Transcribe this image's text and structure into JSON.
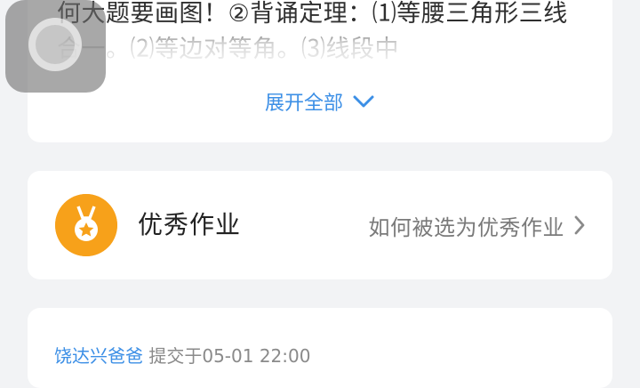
{
  "description": {
    "text": "何大题要画图！②背诵定理：⑴等腰三角形三线合一。⑵等边对等角。⑶线段中",
    "expand_label": "展开全部"
  },
  "excellent": {
    "title": "优秀作业",
    "link_label": "如何被选为优秀作业"
  },
  "submission": {
    "submitter": "饶达兴爸爸",
    "submitted_at": "提交于05-01 22:00"
  },
  "colors": {
    "accent_blue": "#3c8fe6",
    "medal_orange": "#f7a11a"
  },
  "icons": {
    "expand": "chevron-down-icon",
    "link": "chevron-right-icon",
    "medal": "medal-icon"
  }
}
